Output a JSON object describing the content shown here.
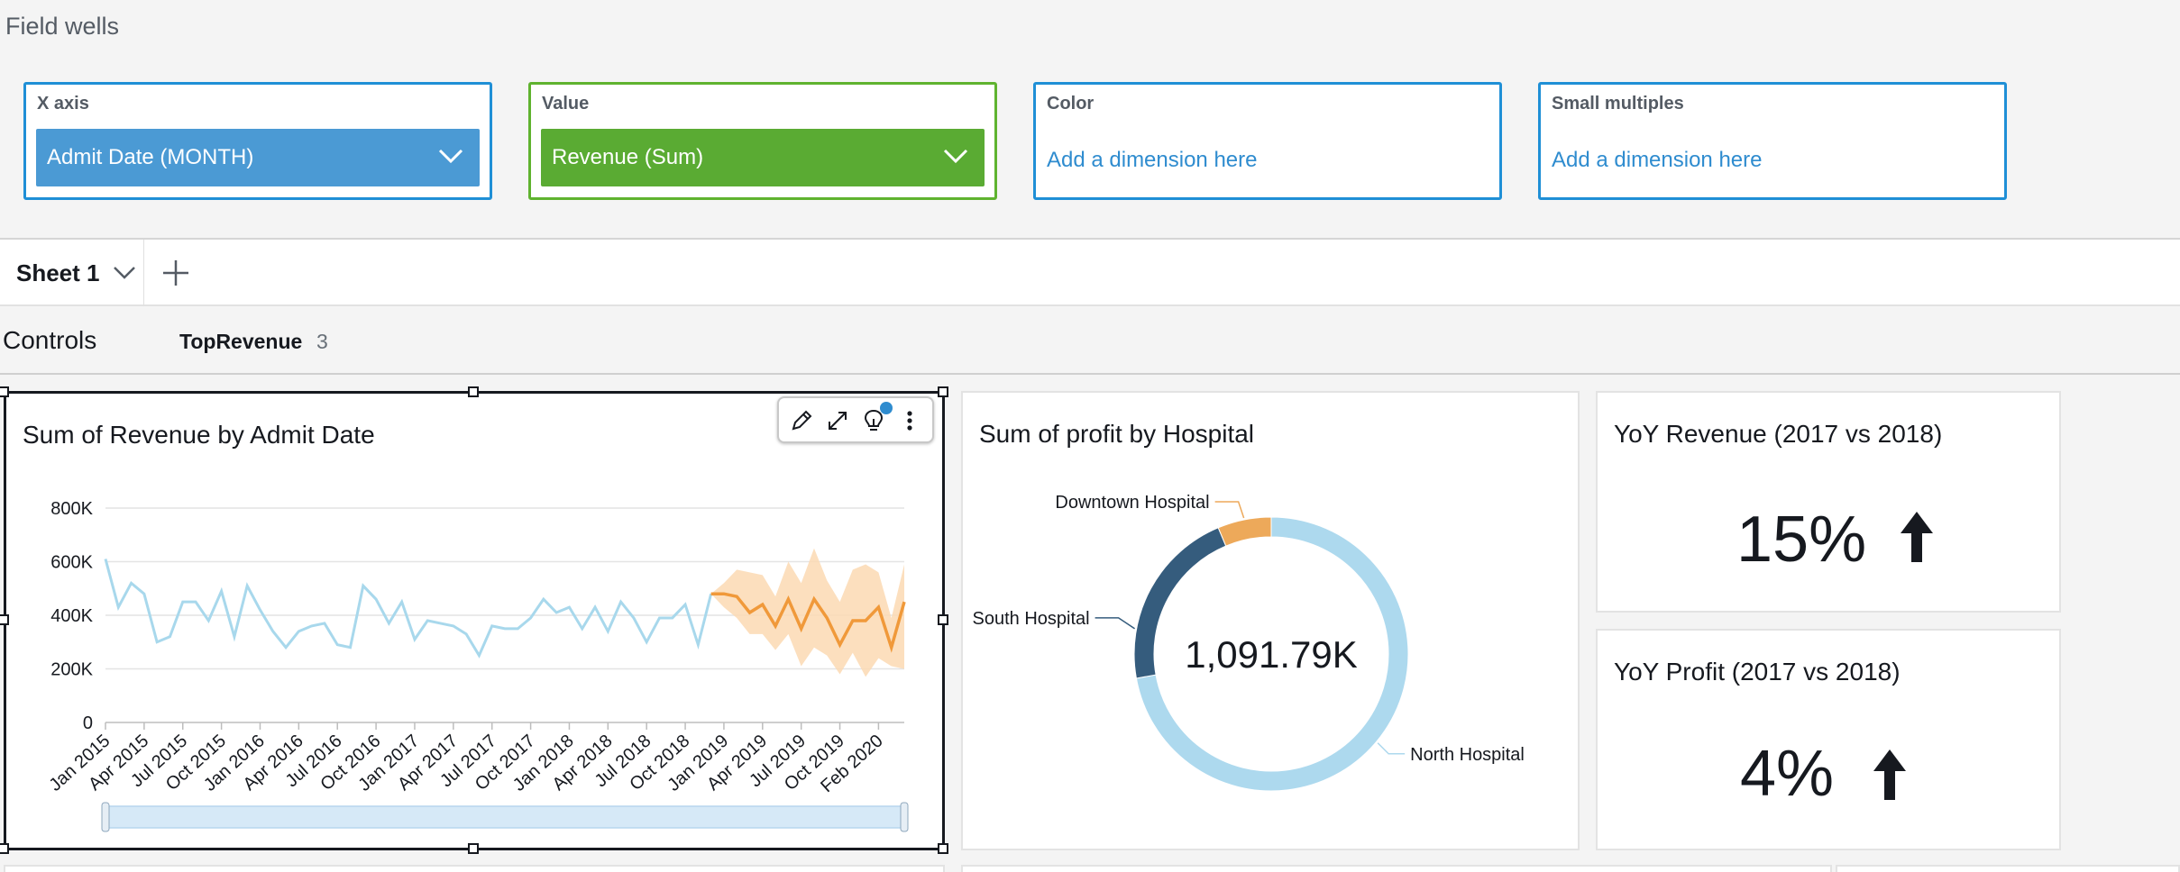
{
  "field_wells": {
    "title": "Field wells",
    "x_axis": {
      "label": "X axis",
      "value": "Admit Date (MONTH)"
    },
    "value": {
      "label": "Value",
      "value": "Revenue (Sum)"
    },
    "color": {
      "label": "Color",
      "placeholder": "Add a dimension here"
    },
    "small_multiples": {
      "label": "Small multiples",
      "placeholder": "Add a dimension here"
    }
  },
  "sheets": {
    "active": "Sheet 1"
  },
  "controls": {
    "label": "Controls",
    "items": [
      {
        "name": "TopRevenue",
        "count": "3"
      }
    ]
  },
  "visuals": {
    "line_chart": {
      "title": "Sum of Revenue by Admit Date"
    },
    "donut_chart": {
      "title": "Sum of profit by Hospital",
      "center_value": "1,091.79K"
    },
    "kpi_revenue": {
      "title": "YoY Revenue (2017 vs 2018)",
      "value": "15%"
    },
    "kpi_profit": {
      "title": "YoY Profit (2017 vs 2018)",
      "value": "4%"
    }
  },
  "colors": {
    "actual": "#a8d8ec",
    "forecast": "#f0993a",
    "forecast_band": "#fcd9b3",
    "north": "#add9ee",
    "south": "#355c7d",
    "downtown": "#eda95a",
    "accent_blue": "#4b9ad4",
    "accent_green": "#5aab33"
  },
  "icons": {
    "edit": "pencil-icon",
    "expand": "expand-icon",
    "insight": "lightbulb-icon",
    "more": "more-vertical-icon",
    "increase": "arrow-up-icon"
  },
  "chart_data": [
    {
      "type": "line",
      "title": "Sum of Revenue by Admit Date",
      "xlabel": "",
      "ylabel": "",
      "ylim": [
        0,
        800000
      ],
      "y_ticks": [
        "800K",
        "600K",
        "400K",
        "200K",
        "0"
      ],
      "x_tick_labels": [
        "Jan 2015",
        "Apr 2015",
        "Jul 2015",
        "Oct 2015",
        "Jan 2016",
        "Apr 2016",
        "Jul 2016",
        "Oct 2016",
        "Jan 2017",
        "Apr 2017",
        "Jul 2017",
        "Oct 2017",
        "Jan 2018",
        "Apr 2018",
        "Jul 2018",
        "Oct 2018",
        "Jan 2019",
        "Apr 2019",
        "Jul 2019",
        "Oct 2019",
        "Feb 2020"
      ],
      "grid": true,
      "series": [
        {
          "values": [
            610000,
            430000,
            520000,
            480000,
            300000,
            320000,
            450000,
            450000,
            380000,
            490000,
            320000,
            510000,
            420000,
            340000,
            280000,
            340000,
            360000,
            370000,
            290000,
            280000,
            510000,
            460000,
            370000,
            450000,
            310000,
            380000,
            370000,
            360000,
            330000,
            250000,
            360000,
            350000,
            350000,
            390000,
            460000,
            410000,
            430000,
            350000,
            430000,
            340000,
            450000,
            390000,
            300000,
            390000,
            390000,
            440000,
            290000,
            480000
          ]
        },
        {
          "values": [
            480000,
            470000,
            410000,
            440000,
            360000,
            460000,
            350000,
            460000,
            390000,
            290000,
            380000,
            380000,
            430000,
            280000,
            450000
          ],
          "band_low": [
            430000,
            390000,
            330000,
            330000,
            270000,
            330000,
            210000,
            280000,
            250000,
            180000,
            260000,
            170000,
            240000,
            210000,
            200000
          ],
          "band_high": [
            520000,
            570000,
            560000,
            550000,
            470000,
            600000,
            520000,
            650000,
            530000,
            450000,
            570000,
            590000,
            560000,
            390000,
            590000
          ]
        }
      ]
    },
    {
      "type": "pie",
      "title": "Sum of profit by Hospital",
      "categories": [
        "North Hospital",
        "South Hospital",
        "Downtown Hospital"
      ],
      "values": [
        788000,
        235000,
        69000
      ],
      "center_label": "1,091.79K"
    }
  ]
}
